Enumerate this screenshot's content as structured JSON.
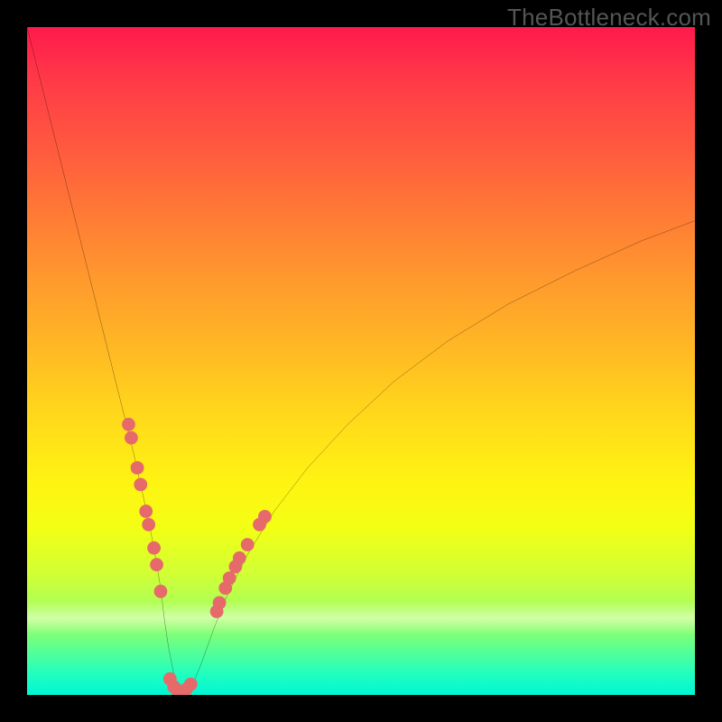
{
  "watermark": "TheBottleneck.com",
  "chart_data": {
    "type": "line",
    "title": "",
    "xlabel": "",
    "ylabel": "",
    "xlim": [
      0,
      100
    ],
    "ylim": [
      0,
      100
    ],
    "grid": false,
    "series": [
      {
        "name": "bottleneck-curve",
        "x": [
          0,
          2,
          4,
          6,
          8,
          10,
          12,
          14,
          16,
          18,
          19,
          20,
          20.6,
          21.2,
          21.8,
          22.3,
          22.8,
          23.4,
          24.1,
          25,
          26.2,
          28,
          30,
          33,
          37,
          42,
          48,
          55,
          63,
          72,
          82,
          92,
          100
        ],
        "values": [
          100,
          92,
          84,
          76,
          68,
          60,
          52,
          44,
          36,
          27,
          22,
          16,
          11,
          7,
          4,
          1.5,
          0.3,
          0.2,
          0.6,
          2,
          5,
          10,
          15,
          21,
          27.5,
          34,
          40.5,
          47,
          53,
          58.5,
          63.5,
          68,
          71
        ]
      }
    ],
    "scatter": {
      "name": "highlight-points",
      "color": "#e66a6a",
      "radius_pct": 1.0,
      "points": [
        {
          "x": 15.2,
          "y": 40.5
        },
        {
          "x": 15.6,
          "y": 38.5
        },
        {
          "x": 16.5,
          "y": 34.0
        },
        {
          "x": 17.0,
          "y": 31.5
        },
        {
          "x": 17.8,
          "y": 27.5
        },
        {
          "x": 18.2,
          "y": 25.5
        },
        {
          "x": 19.0,
          "y": 22.0
        },
        {
          "x": 19.4,
          "y": 19.5
        },
        {
          "x": 20.0,
          "y": 15.5
        },
        {
          "x": 21.4,
          "y": 2.4
        },
        {
          "x": 22.0,
          "y": 1.2
        },
        {
          "x": 22.6,
          "y": 0.6
        },
        {
          "x": 23.2,
          "y": 0.5
        },
        {
          "x": 23.8,
          "y": 0.8
        },
        {
          "x": 24.5,
          "y": 1.6
        },
        {
          "x": 28.4,
          "y": 12.5
        },
        {
          "x": 28.8,
          "y": 13.8
        },
        {
          "x": 29.7,
          "y": 16.0
        },
        {
          "x": 30.3,
          "y": 17.5
        },
        {
          "x": 31.2,
          "y": 19.2
        },
        {
          "x": 31.8,
          "y": 20.5
        },
        {
          "x": 33.0,
          "y": 22.5
        },
        {
          "x": 34.8,
          "y": 25.5
        },
        {
          "x": 35.6,
          "y": 26.7
        }
      ]
    }
  }
}
